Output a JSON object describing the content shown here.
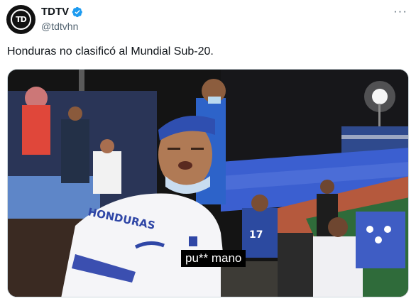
{
  "author": {
    "display_name": "TDTV",
    "handle": "@tdtvhn",
    "avatar_text": "TD",
    "verified_color": "#1d9bf0"
  },
  "menu": {
    "more_label": "···"
  },
  "tweet": {
    "text": "Honduras no clasificó al Mundial Sub-20."
  },
  "media": {
    "subtitle": "pu** mano",
    "jersey_text": "HONDURAS",
    "jersey_number": "17",
    "colors": {
      "stadium_blue": "#3b5fd0",
      "night_sky": "#141414",
      "track": "#b5593d",
      "field": "#2f6b3a"
    }
  }
}
